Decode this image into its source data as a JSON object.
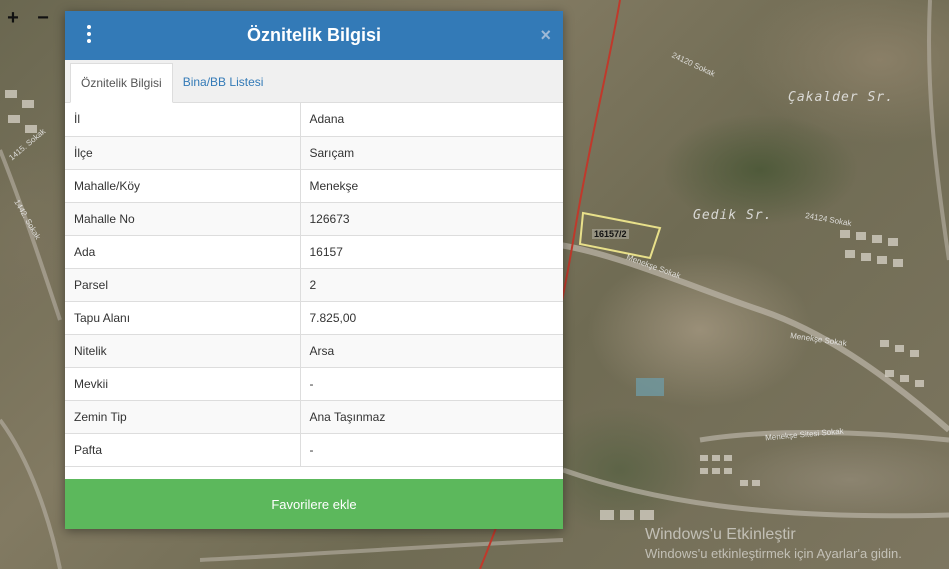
{
  "map": {
    "controls": {
      "zoom_in": "+",
      "zoom_out": "−"
    },
    "street_labels": {
      "cakalder": "Çakalder Sr.",
      "gedik": "Gedik Sr.",
      "menekse_sokak": "Menekşe Sokak",
      "menekse_sitesi": "Menekşe Sitesi Sokak",
      "sokak_24124": "24124 Sokak",
      "sokak_24120": "24120 Sokak",
      "sokak_1442": "1442. Sokak",
      "sokak_1415": "1415. Sokak"
    },
    "parcel_label": "16157/2"
  },
  "panel": {
    "title": "Öznitelik Bilgisi",
    "close_label": "×",
    "tabs": [
      {
        "label": "Öznitelik Bilgisi",
        "active": true
      },
      {
        "label": "Bina/BB Listesi",
        "active": false
      }
    ],
    "rows": [
      {
        "key": "İl",
        "value": "Adana"
      },
      {
        "key": "İlçe",
        "value": "Sarıçam"
      },
      {
        "key": "Mahalle/Köy",
        "value": "Menekşe"
      },
      {
        "key": "Mahalle No",
        "value": "126673"
      },
      {
        "key": "Ada",
        "value": "16157"
      },
      {
        "key": "Parsel",
        "value": "2"
      },
      {
        "key": "Tapu Alanı",
        "value": "7.825,00"
      },
      {
        "key": "Nitelik",
        "value": "Arsa"
      },
      {
        "key": "Mevkii",
        "value": "-"
      },
      {
        "key": "Zemin Tip",
        "value": "Ana Taşınmaz"
      },
      {
        "key": "Pafta",
        "value": "-"
      }
    ],
    "favorite_button": "Favorilere ekle"
  },
  "watermark": {
    "title": "Windows'u Etkinleştir",
    "subtitle": "Windows'u etkinleştirmek için Ayarlar'a gidin."
  },
  "colors": {
    "header": "#337ab7",
    "button": "#5cb85c",
    "parcel_outline": "#e8e08a",
    "boundary_line": "#c0392b"
  }
}
